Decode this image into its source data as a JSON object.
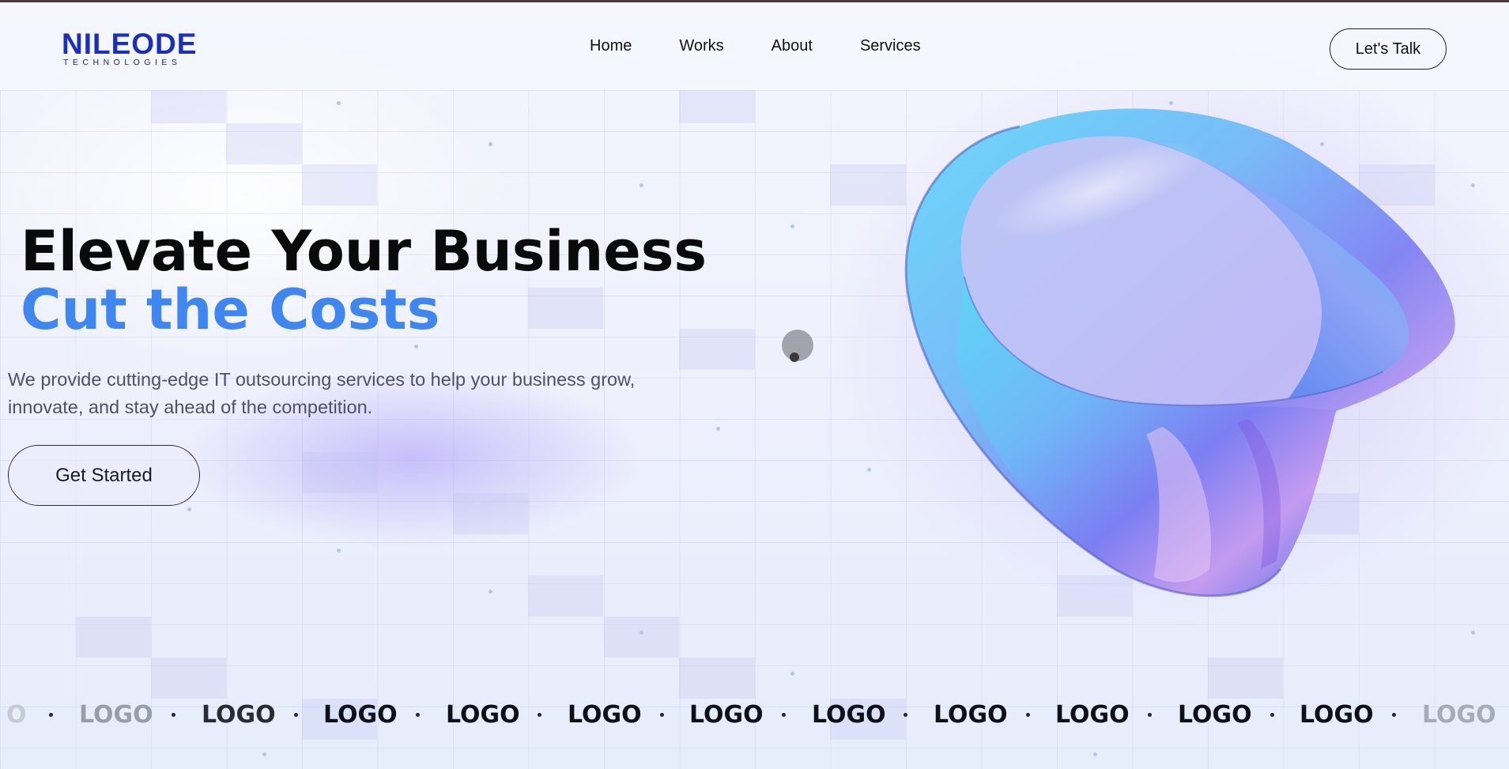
{
  "brand": {
    "name": "NILEODE",
    "tagline": "TECHNOLOGIES",
    "color": "#1b2fb8"
  },
  "nav": {
    "items": [
      {
        "label": "Home"
      },
      {
        "label": "Works"
      },
      {
        "label": "About"
      },
      {
        "label": "Services"
      }
    ],
    "cta_label": "Let's Talk"
  },
  "hero": {
    "title": "Elevate Your Business",
    "subtitle": "Cut the Costs",
    "subtitle_color": "#3f86ee",
    "description": "We provide cutting-edge IT outsourcing services to help your business grow, innovate, and stay ahead of the competition.",
    "cta_label": "Get Started",
    "art_icon": "iridescent-ring-3d"
  },
  "logo_strip": {
    "items": [
      "O",
      "LOGO",
      "LOGO",
      "LOGO",
      "LOGO",
      "LOGO",
      "LOGO",
      "LOGO",
      "LOGO",
      "LOGO",
      "LOGO",
      "LOGO",
      "LOGO"
    ]
  }
}
